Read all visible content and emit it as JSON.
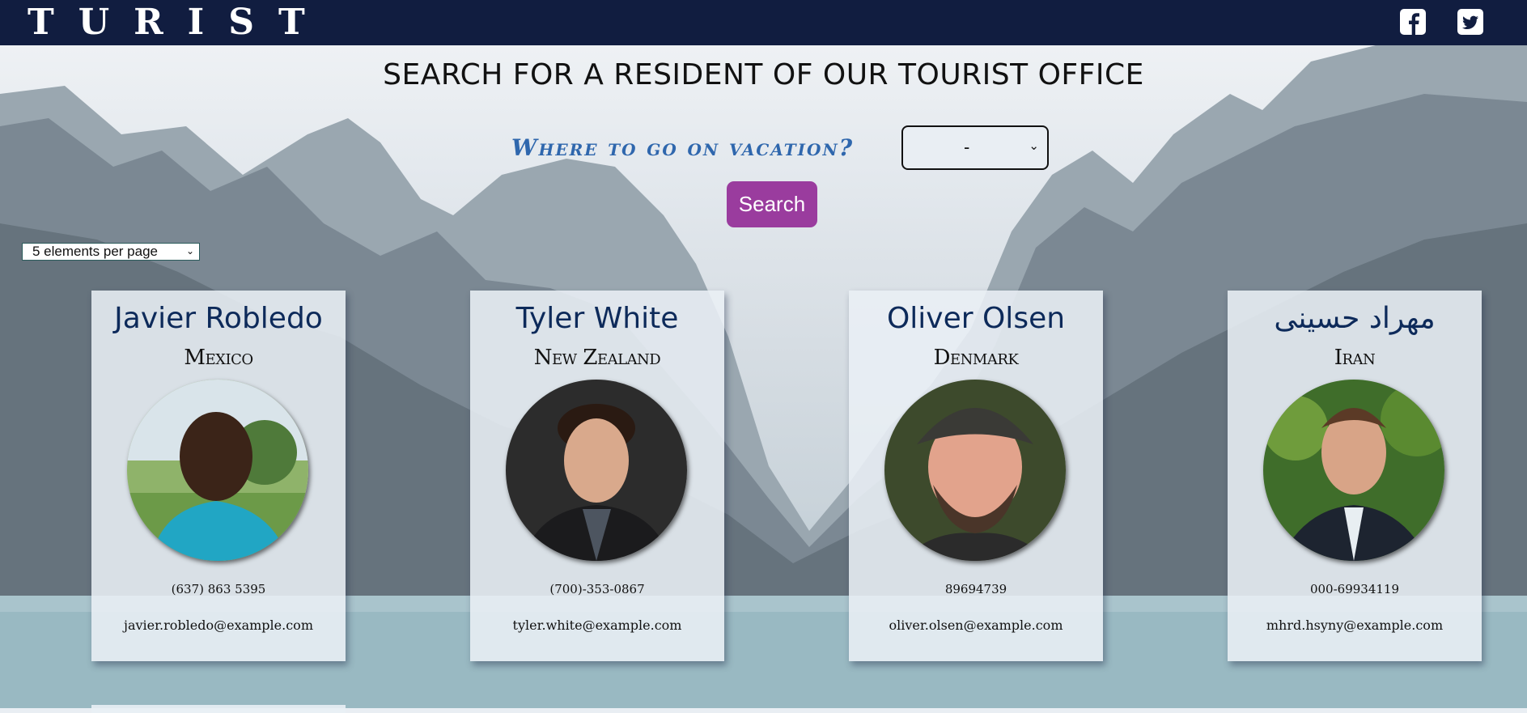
{
  "header": {
    "logo": "TURIST",
    "social": [
      "facebook-icon",
      "twitter-icon"
    ],
    "bg_color": "#111d40"
  },
  "search": {
    "title": "SEARCH FOR A RESIDENT OF OUR TOURIST OFFICE",
    "question": "Where to go on vacation?",
    "country_selected": "-",
    "button_label": "Search",
    "button_color": "#9a3c9e"
  },
  "pagination": {
    "per_page_selected": "5 elements per page"
  },
  "residents": [
    {
      "name": "Javier Robledo",
      "country": "Mexico",
      "phone": "(637) 863 5395",
      "email": "javier.robledo@example.com"
    },
    {
      "name": "Tyler White",
      "country": "New Zealand",
      "phone": "(700)-353-0867",
      "email": "tyler.white@example.com"
    },
    {
      "name": "Oliver Olsen",
      "country": "Denmark",
      "phone": "89694739",
      "email": "oliver.olsen@example.com"
    },
    {
      "name": "مهراد حسینی",
      "country": "Iran",
      "phone": "000-69934119",
      "email": "mhrd.hsyny@example.com"
    }
  ]
}
